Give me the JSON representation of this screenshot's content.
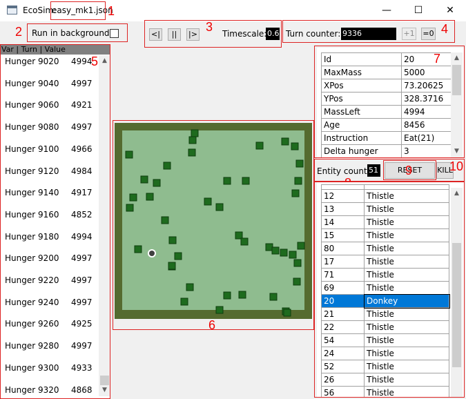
{
  "window": {
    "title_prefix": "EcoSim:",
    "file_name": "easy_mk1.json",
    "minimize_glyph": "—",
    "maximize_glyph": "☐",
    "close_glyph": "✕"
  },
  "annotations": [
    "1",
    "2",
    "3",
    "4",
    "5",
    "6",
    "7",
    "8",
    "9",
    "10"
  ],
  "background_control": {
    "label": "Run in background:",
    "checked": false
  },
  "playback": {
    "back_label": "<|",
    "pause_label": "||",
    "forward_label": "|>",
    "timescale_label": "Timescale:",
    "timescale_value": "0.6"
  },
  "turn": {
    "label": "Turn counter:",
    "value": "9336",
    "plus_label": "+1",
    "reset_label": "=0"
  },
  "history": {
    "header": "Var | Turn | Value",
    "rows": [
      {
        "var": "Hunger",
        "turn": "9020",
        "value": "4994"
      },
      {
        "var": "Hunger",
        "turn": "9040",
        "value": "4997"
      },
      {
        "var": "Hunger",
        "turn": "9060",
        "value": "4921"
      },
      {
        "var": "Hunger",
        "turn": "9080",
        "value": "4997"
      },
      {
        "var": "Hunger",
        "turn": "9100",
        "value": "4966"
      },
      {
        "var": "Hunger",
        "turn": "9120",
        "value": "4984"
      },
      {
        "var": "Hunger",
        "turn": "9140",
        "value": "4917"
      },
      {
        "var": "Hunger",
        "turn": "9160",
        "value": "4852"
      },
      {
        "var": "Hunger",
        "turn": "9180",
        "value": "4994"
      },
      {
        "var": "Hunger",
        "turn": "9200",
        "value": "4997"
      },
      {
        "var": "Hunger",
        "turn": "9220",
        "value": "4997"
      },
      {
        "var": "Hunger",
        "turn": "9240",
        "value": "4997"
      },
      {
        "var": "Hunger",
        "turn": "9260",
        "value": "4925"
      },
      {
        "var": "Hunger",
        "turn": "9280",
        "value": "4997"
      },
      {
        "var": "Hunger",
        "turn": "9300",
        "value": "4933"
      },
      {
        "var": "Hunger",
        "turn": "9320",
        "value": "4868"
      }
    ]
  },
  "world": {
    "field_color": "#8fbc8f",
    "border_color": "#556b2f",
    "plant_color": "#1e6b1e",
    "animal_color": "#404040"
  },
  "properties": [
    {
      "key": "Id",
      "value": "20"
    },
    {
      "key": "MaxMass",
      "value": "5000"
    },
    {
      "key": "XPos",
      "value": "73.20625"
    },
    {
      "key": "YPos",
      "value": "328.3716"
    },
    {
      "key": "MassLeft",
      "value": "4994"
    },
    {
      "key": "Age",
      "value": "8456"
    },
    {
      "key": "Instruction",
      "value": "Eat(21)"
    },
    {
      "key": "Delta hunger",
      "value": "3"
    }
  ],
  "entity_panel": {
    "count_label": "Entity count:",
    "count_value": "51",
    "reset_brain_label": "RESET BRAIN",
    "kill_label": "KILL"
  },
  "entities": [
    {
      "id": "12",
      "name": "Thistle"
    },
    {
      "id": "13",
      "name": "Thistle"
    },
    {
      "id": "14",
      "name": "Thistle"
    },
    {
      "id": "15",
      "name": "Thistle"
    },
    {
      "id": "80",
      "name": "Thistle"
    },
    {
      "id": "17",
      "name": "Thistle"
    },
    {
      "id": "71",
      "name": "Thistle"
    },
    {
      "id": "69",
      "name": "Thistle"
    },
    {
      "id": "20",
      "name": "Donkey"
    },
    {
      "id": "21",
      "name": "Thistle"
    },
    {
      "id": "22",
      "name": "Thistle"
    },
    {
      "id": "54",
      "name": "Thistle"
    },
    {
      "id": "24",
      "name": "Thistle"
    },
    {
      "id": "52",
      "name": "Thistle"
    },
    {
      "id": "26",
      "name": "Thistle"
    },
    {
      "id": "56",
      "name": "Thistle"
    }
  ],
  "selected_entity_index": 8
}
